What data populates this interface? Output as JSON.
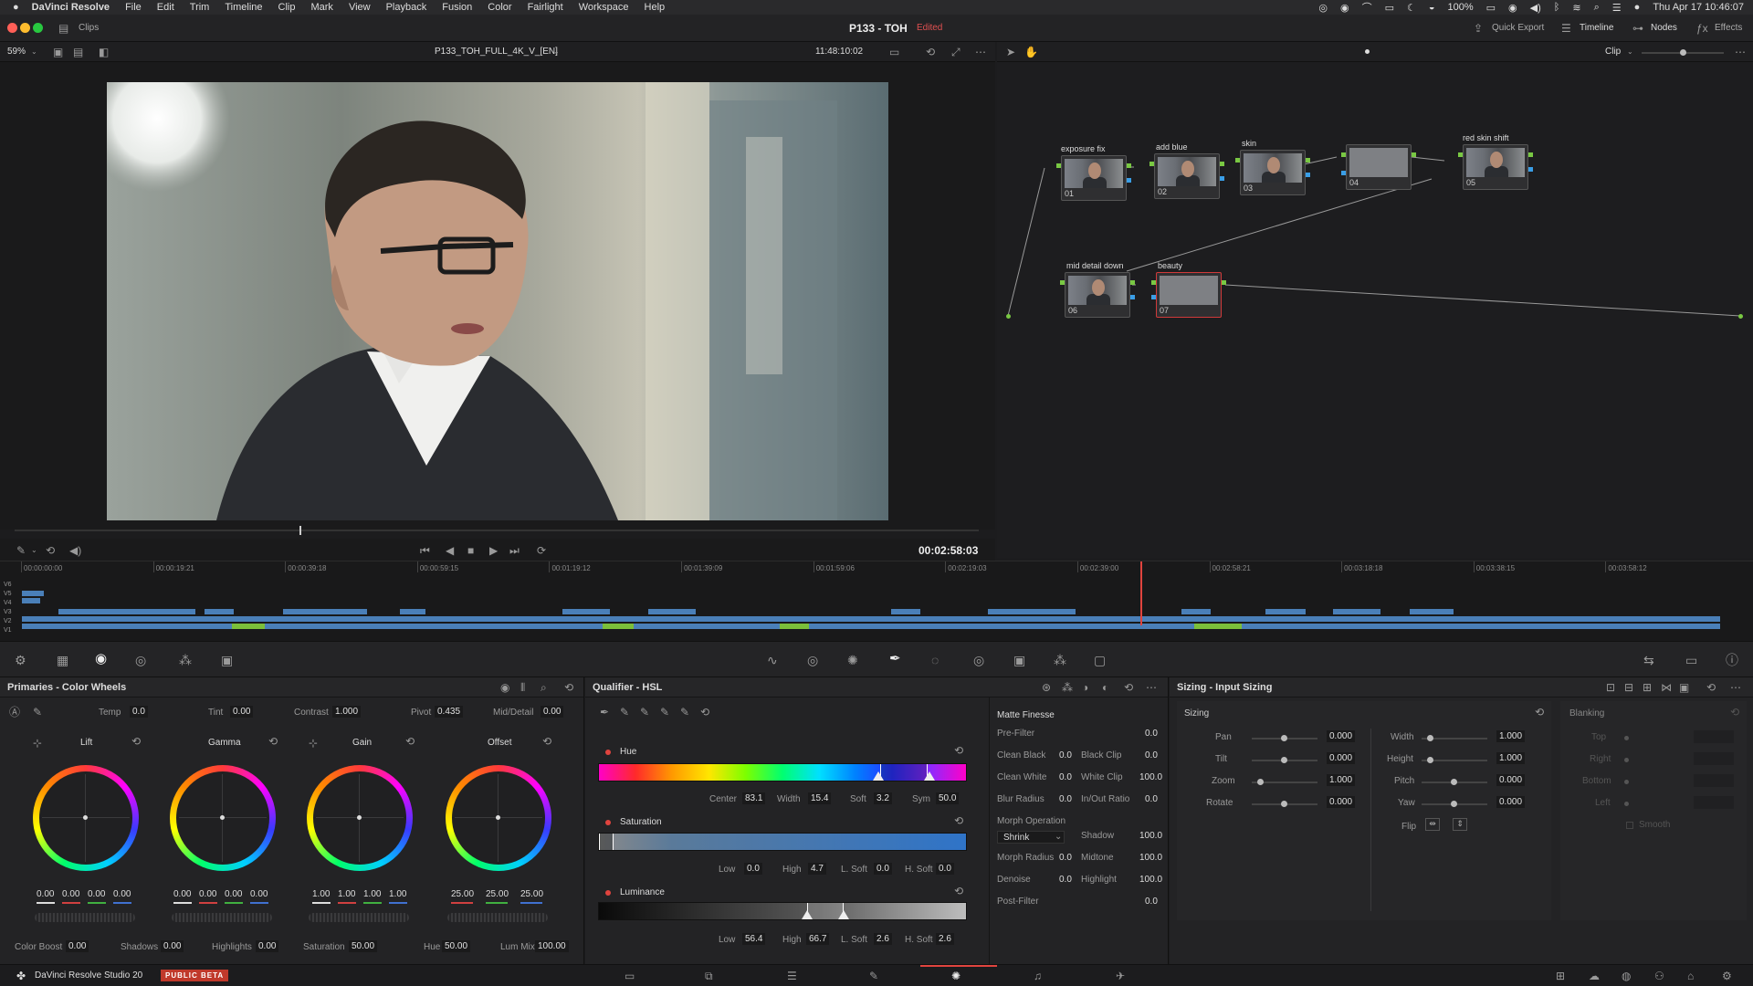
{
  "menu": {
    "apple": "",
    "app": "DaVinci Resolve",
    "items": [
      "File",
      "Edit",
      "Trim",
      "Timeline",
      "Clip",
      "Mark",
      "View",
      "Playback",
      "Fusion",
      "Color",
      "Fairlight",
      "Workspace",
      "Help"
    ],
    "battery": "100%",
    "datetime": "Thu Apr 17  10:46:07"
  },
  "titlebar": {
    "clips_label": "Clips",
    "project": "P133 - TOH",
    "edited": "Edited",
    "quick_export": "Quick Export",
    "timeline": "Timeline",
    "nodes": "Nodes",
    "effects": "Effects"
  },
  "viewer": {
    "zoom": "59%",
    "clip_name": "P133_TOH_FULL_4K_V_[EN]",
    "source_tc": "11:48:10:02",
    "node_mode": "Clip",
    "record_tc": "00:02:58:03"
  },
  "nodes": [
    {
      "label": "exposure fix",
      "num": "01"
    },
    {
      "label": "add blue",
      "num": "02"
    },
    {
      "label": "skin",
      "num": "03"
    },
    {
      "label": "",
      "num": "04"
    },
    {
      "label": "red skin shift",
      "num": "05"
    },
    {
      "label": "mid detail down",
      "num": "06"
    },
    {
      "label": "beauty",
      "num": "07"
    }
  ],
  "timeline": {
    "tracks": [
      "V6",
      "V5",
      "V4",
      "V3",
      "V2",
      "V1"
    ],
    "ruler": [
      "00:00:00:00",
      "00:00:19:21",
      "00:00:39:18",
      "00:00:59:15",
      "00:01:19:12",
      "00:01:39:09",
      "00:01:59:06",
      "00:02:19:03",
      "00:02:39:00",
      "00:02:58:21",
      "00:03:18:18",
      "00:03:38:15",
      "00:03:58:12"
    ],
    "playhead_fraction": 0.705
  },
  "primaries": {
    "title": "Primaries - Color Wheels",
    "top": [
      {
        "label": "Temp",
        "value": "0.0"
      },
      {
        "label": "Tint",
        "value": "0.00"
      },
      {
        "label": "Contrast",
        "value": "1.000"
      },
      {
        "label": "Pivot",
        "value": "0.435"
      },
      {
        "label": "Mid/Detail",
        "value": "0.00"
      }
    ],
    "wheels": [
      {
        "name": "Lift",
        "values": [
          "0.00",
          "0.00",
          "0.00",
          "0.00"
        ]
      },
      {
        "name": "Gamma",
        "values": [
          "0.00",
          "0.00",
          "0.00",
          "0.00"
        ]
      },
      {
        "name": "Gain",
        "values": [
          "1.00",
          "1.00",
          "1.00",
          "1.00"
        ]
      },
      {
        "name": "Offset",
        "values": [
          "25.00",
          "25.00",
          "25.00"
        ]
      }
    ],
    "bottom": [
      {
        "label": "Color Boost",
        "value": "0.00"
      },
      {
        "label": "Shadows",
        "value": "0.00"
      },
      {
        "label": "Highlights",
        "value": "0.00"
      },
      {
        "label": "Saturation",
        "value": "50.00"
      },
      {
        "label": "Hue",
        "value": "50.00"
      },
      {
        "label": "Lum Mix",
        "value": "100.00"
      }
    ]
  },
  "qualifier": {
    "title": "Qualifier - HSL",
    "hue_label": "Hue",
    "hue": [
      {
        "label": "Center",
        "value": "83.1"
      },
      {
        "label": "Width",
        "value": "15.4"
      },
      {
        "label": "Soft",
        "value": "3.2"
      },
      {
        "label": "Sym",
        "value": "50.0"
      }
    ],
    "sat_label": "Saturation",
    "sat": [
      {
        "label": "Low",
        "value": "0.0"
      },
      {
        "label": "High",
        "value": "4.7"
      },
      {
        "label": "L. Soft",
        "value": "0.0"
      },
      {
        "label": "H. Soft",
        "value": "0.0"
      }
    ],
    "lum_label": "Luminance",
    "lum": [
      {
        "label": "Low",
        "value": "56.4"
      },
      {
        "label": "High",
        "value": "66.7"
      },
      {
        "label": "L. Soft",
        "value": "2.6"
      },
      {
        "label": "H. Soft",
        "value": "2.6"
      }
    ]
  },
  "matte": {
    "title": "Matte Finesse",
    "prefilter": {
      "label": "Pre-Filter",
      "value": "0.0"
    },
    "rows": [
      [
        {
          "label": "Clean Black",
          "value": "0.0"
        },
        {
          "label": "Black Clip",
          "value": "0.0"
        }
      ],
      [
        {
          "label": "Clean White",
          "value": "0.0"
        },
        {
          "label": "White Clip",
          "value": "100.0"
        }
      ],
      [
        {
          "label": "Blur Radius",
          "value": "0.0"
        },
        {
          "label": "In/Out Ratio",
          "value": "0.0"
        }
      ]
    ],
    "morph_label": "Morph Operation",
    "morph_value": "Shrink",
    "shadow": {
      "label": "Shadow",
      "value": "100.0"
    },
    "morph_radius": {
      "label": "Morph Radius",
      "value": "0.0"
    },
    "midtone": {
      "label": "Midtone",
      "value": "100.0"
    },
    "denoise": {
      "label": "Denoise",
      "value": "0.0"
    },
    "highlight": {
      "label": "Highlight",
      "value": "100.0"
    },
    "postfilter": {
      "label": "Post-Filter",
      "value": "0.0"
    }
  },
  "sizing": {
    "title": "Sizing - Input Sizing",
    "section": "Sizing",
    "left": [
      {
        "label": "Pan",
        "value": "0.000"
      },
      {
        "label": "Tilt",
        "value": "0.000"
      },
      {
        "label": "Zoom",
        "value": "1.000"
      },
      {
        "label": "Rotate",
        "value": "0.000"
      }
    ],
    "right": [
      {
        "label": "Width",
        "value": "1.000"
      },
      {
        "label": "Height",
        "value": "1.000"
      },
      {
        "label": "Pitch",
        "value": "0.000"
      },
      {
        "label": "Yaw",
        "value": "0.000"
      }
    ],
    "flip": "Flip",
    "blanking": "Blanking",
    "blanking_items": [
      "Top",
      "Right",
      "Bottom",
      "Left"
    ],
    "smooth": "Smooth"
  },
  "status": {
    "app": "DaVinci Resolve Studio 20",
    "badge": "PUBLIC BETA"
  }
}
